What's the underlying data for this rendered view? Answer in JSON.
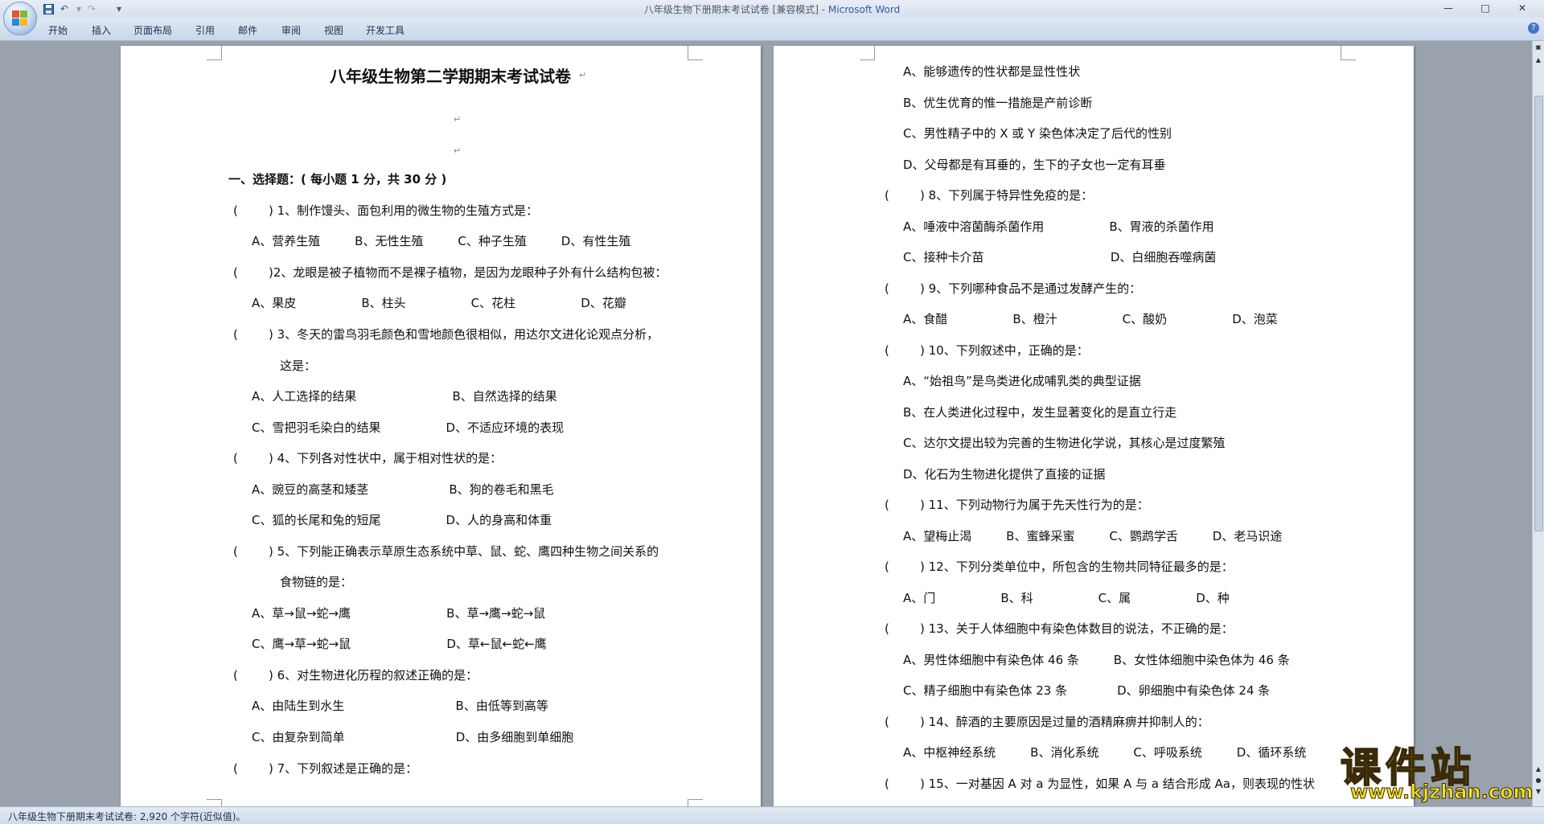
{
  "window": {
    "title": "八年级生物下册期末考试试卷 [兼容模式] - ",
    "app_name": "Microsoft Word"
  },
  "quick_access": {
    "save_icon": "save-icon",
    "undo_label": "↶",
    "redo_label": "↷",
    "customize_label": "▾"
  },
  "ribbon": {
    "tabs": [
      "开始",
      "插入",
      "页面布局",
      "引用",
      "邮件",
      "审阅",
      "视图",
      "开发工具"
    ],
    "help_label": "?"
  },
  "page1": {
    "lines": [
      "八年级生物第二学期期末考试试卷",
      "",
      "",
      "一、选择题：( 每小题 1 分，共 30 分 )",
      "(        ) 1、制作馒头、面包利用的微生物的生殖方式是：",
      "A、营养生殖         B、无性生殖         C、种子生殖         D、有性生殖",
      "(        )2、龙眼是被子植物而不是裸子植物，是因为龙眼种子外有什么结构包被：",
      "A、果皮                 B、柱头                 C、花柱                 D、花瓣",
      "(        ) 3、冬天的雷鸟羽毛颜色和雪地颜色很相似，用达尔文进化论观点分析，",
      "这是：",
      "A、人工选择的结果                         B、自然选择的结果",
      "C、雪把羽毛染白的结果                 D、不适应环境的表现",
      "(        ) 4、下列各对性状中，属于相对性状的是：",
      "A、豌豆的高茎和矮茎                     B、狗的卷毛和黑毛",
      "C、狐的长尾和兔的短尾                 D、人的身高和体重",
      "(        ) 5、下列能正确表示草原生态系统中草、鼠、蛇、鹰四种生物之间关系的",
      "食物链的是：",
      "A、草→鼠→蛇→鹰                         B、草→鹰→蛇→鼠",
      "C、鹰→草→蛇→鼠                         D、草←鼠←蛇←鹰",
      "(        ) 6、对生物进化历程的叙述正确的是：",
      "A、由陆生到水生                             B、由低等到高等",
      "C、由复杂到简单                             D、由多细胞到单细胞",
      "(        ) 7、下列叙述是正确的是："
    ]
  },
  "page2": {
    "lines": [
      "A、能够遗传的性状都是显性性状",
      "B、优生优育的惟一措施是产前诊断",
      "C、男性精子中的 X 或 Y 染色体决定了后代的性别",
      "D、父母都是有耳垂的，生下的子女也一定有耳垂",
      "(        ) 8、下列属于特异性免疫的是：",
      "A、唾液中溶菌酶杀菌作用                 B、胃液的杀菌作用",
      "C、接种卡介苗                                 D、白细胞吞噬病菌",
      "(        ) 9、下列哪种食品不是通过发酵产生的：",
      "A、食醋                 B、橙汁                 C、酸奶                 D、泡菜",
      "(        ) 10、下列叙述中，正确的是：",
      "A、“始祖鸟”是鸟类进化成哺乳类的典型证据",
      "B、在人类进化过程中，发生显著变化的是直立行走",
      "C、达尔文提出较为完善的生物进化学说，其核心是过度繁殖",
      "D、化石为生物进化提供了直接的证据",
      "(        ) 11、下列动物行为属于先天性行为的是：",
      "A、望梅止渴         B、蜜蜂采蜜         C、鹦鹉学舌         D、老马识途",
      "(        ) 12、下列分类单位中，所包含的生物共同特征最多的是：",
      "A、门                 B、科                 C、属                 D、种",
      "(        ) 13、关于人体细胞中有染色体数目的说法，不正确的是：",
      "A、男性体细胞中有染色体 46 条         B、女性体细胞中染色体为 46 条",
      "C、精子细胞中有染色体 23 条             D、卵细胞中有染色体 24 条",
      "(        ) 14、醉酒的主要原因是过量的酒精麻痹并抑制人的：",
      "A、中枢神经系统         B、消化系统         C、呼吸系统         D、循环系统",
      "(        ) 15、一对基因 A 对 a 为显性，如果 A 与 a 结合形成 Aa，则表现的性状"
    ]
  },
  "status": {
    "text": "八年级生物下册期末考试试卷: 2,920 个字符(近似值)。"
  },
  "watermark": {
    "main": "课件站",
    "url": "www.kjzhan.com"
  }
}
